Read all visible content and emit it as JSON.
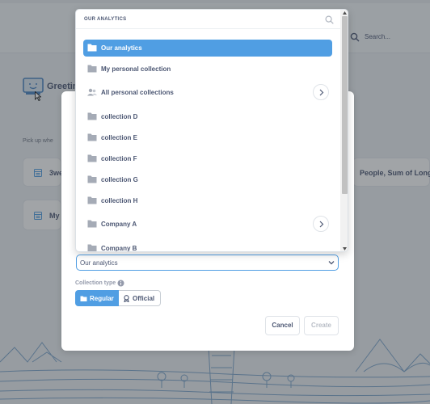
{
  "background": {
    "search_placeholder": "Search...",
    "greeting": "Greetin",
    "pickup_text": "Pick up whe",
    "cards": [
      {
        "label": "3we"
      },
      {
        "label": "My"
      },
      {
        "label": "People, Sum of Longit"
      }
    ]
  },
  "picker": {
    "title": "OUR ANALYTICS",
    "items": [
      {
        "label": "Our analytics",
        "icon": "folder-icon",
        "selected": true
      },
      {
        "label": "My personal collection",
        "icon": "folder-icon"
      },
      {
        "label": "All personal collections",
        "icon": "people-icon",
        "has_children": true
      },
      {
        "label": "collection D",
        "icon": "folder-icon"
      },
      {
        "label": "collection E",
        "icon": "folder-icon"
      },
      {
        "label": "collection F",
        "icon": "folder-icon"
      },
      {
        "label": "collection G",
        "icon": "folder-icon"
      },
      {
        "label": "collection H",
        "icon": "folder-icon"
      },
      {
        "label": "Company A",
        "icon": "folder-icon",
        "has_children": true
      },
      {
        "label": "Company B",
        "icon": "folder-icon"
      }
    ]
  },
  "modal": {
    "collection_value": "Our analytics",
    "collection_type_label": "Collection type",
    "type_options": [
      {
        "label": "Regular",
        "selected": true,
        "icon": "folder-icon"
      },
      {
        "label": "Official",
        "selected": false,
        "icon": "badge-icon"
      }
    ],
    "cancel_label": "Cancel",
    "create_label": "Create"
  },
  "colors": {
    "accent": "#509ee3",
    "text": "#4c5773",
    "muted": "#949aab"
  }
}
